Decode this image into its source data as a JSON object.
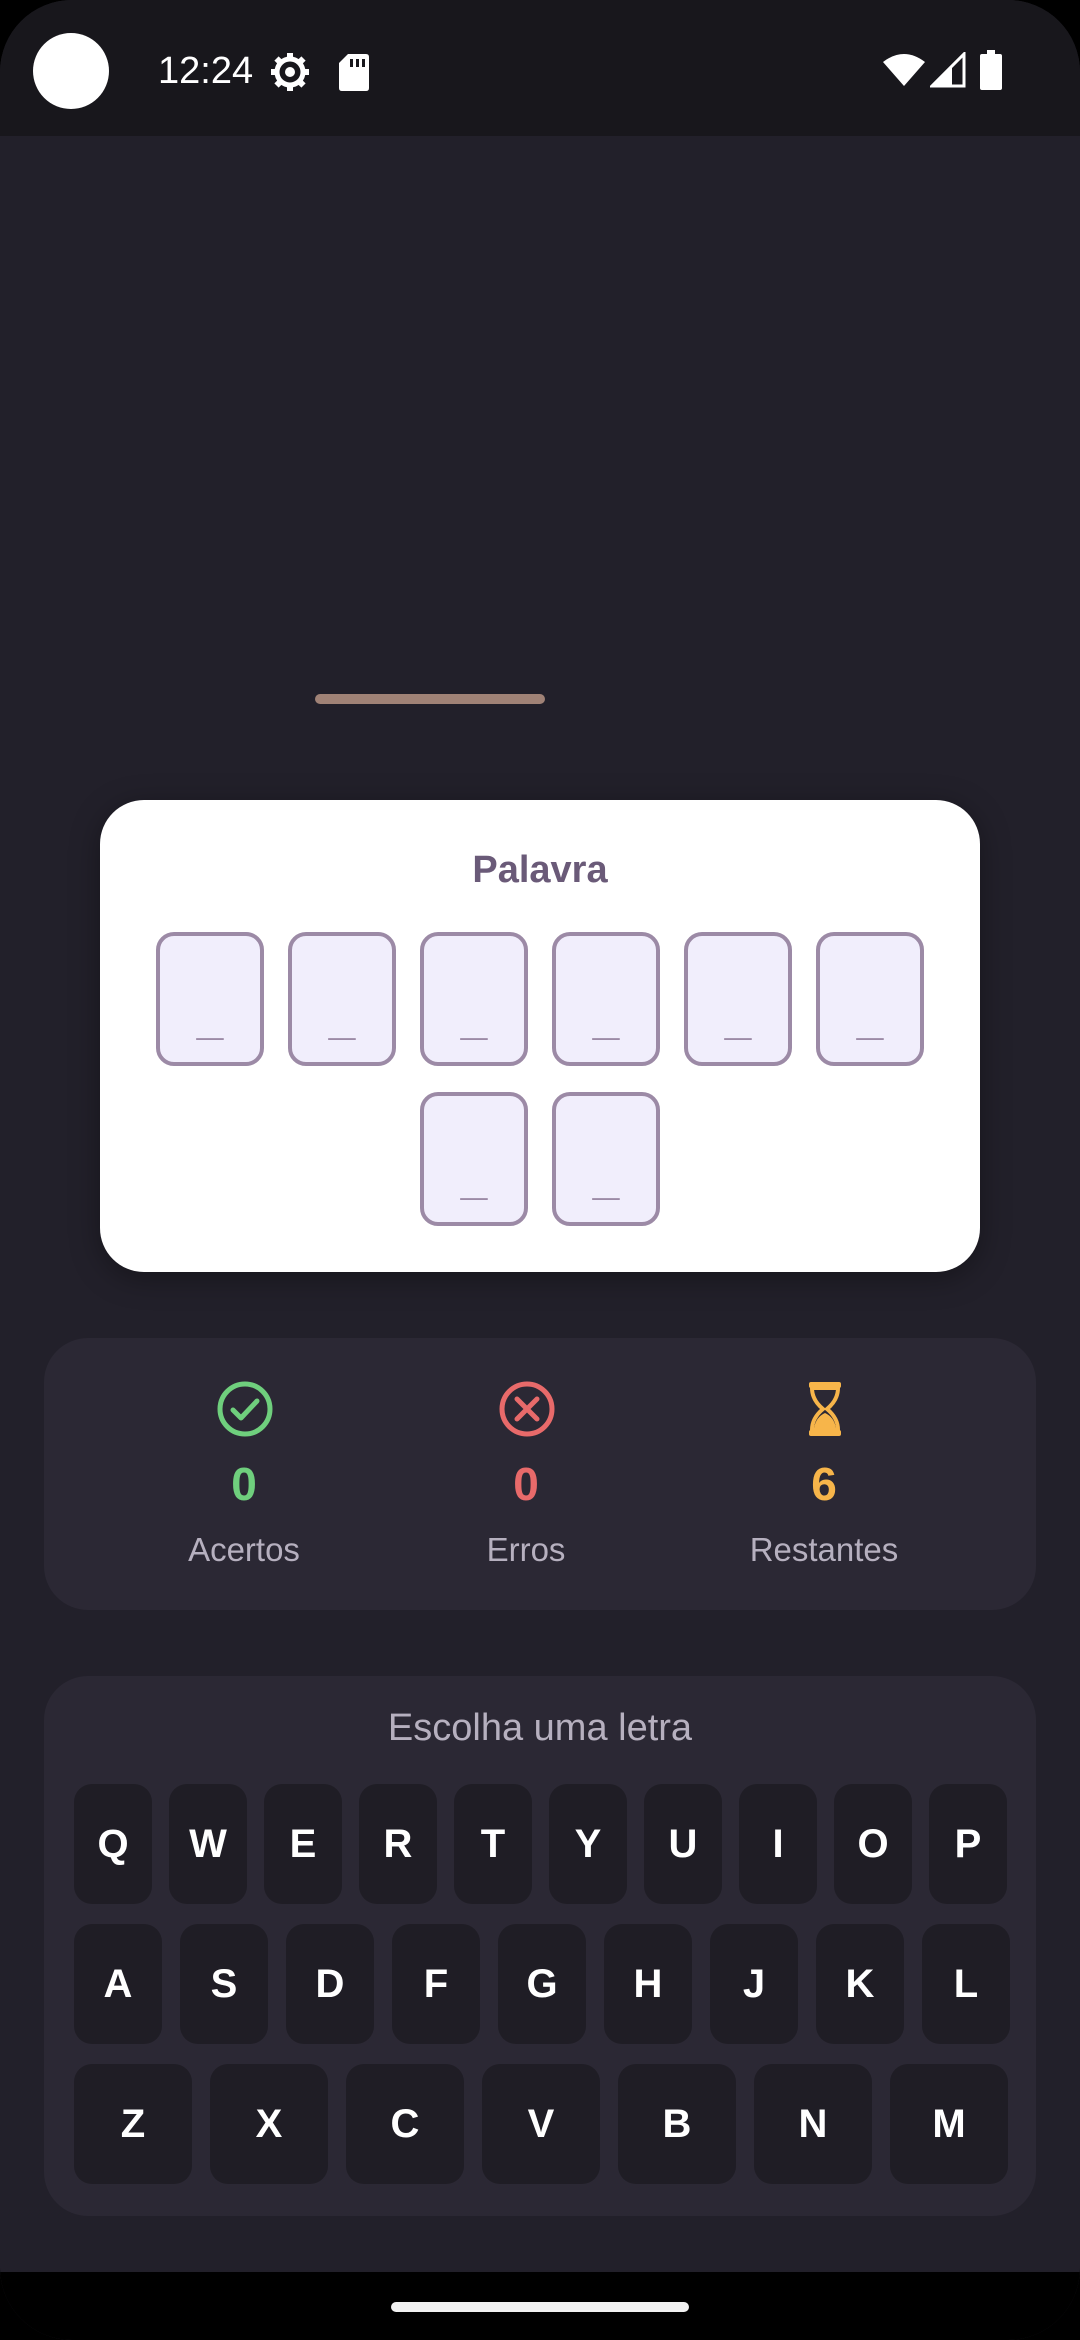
{
  "status_bar": {
    "time": "12:24",
    "icons": [
      "settings-icon",
      "sdcard-icon",
      "wifi-icon",
      "signal-icon",
      "battery-icon"
    ]
  },
  "word_card": {
    "title": "Palavra",
    "slots": [
      "_",
      "_",
      "_",
      "_",
      "_",
      "_",
      "_",
      "_"
    ]
  },
  "stats": {
    "hits": {
      "value": "0",
      "label": "Acertos",
      "icon": "check-circle-icon",
      "color": "#6fcf7d"
    },
    "errors": {
      "value": "0",
      "label": "Erros",
      "icon": "x-circle-icon",
      "color": "#e86a6a"
    },
    "remaining": {
      "value": "6",
      "label": "Restantes",
      "icon": "hourglass-icon",
      "color": "#f7b54a"
    }
  },
  "keyboard": {
    "prompt": "Escolha uma letra",
    "rows": [
      [
        "Q",
        "W",
        "E",
        "R",
        "T",
        "Y",
        "U",
        "I",
        "O",
        "P"
      ],
      [
        "A",
        "S",
        "D",
        "F",
        "G",
        "H",
        "J",
        "K",
        "L"
      ],
      [
        "Z",
        "X",
        "C",
        "V",
        "B",
        "N",
        "M"
      ]
    ]
  },
  "colors": {
    "background": "#22202a",
    "panel": "#2b2834",
    "key": "#1f1d25",
    "slot_fill": "#f1eefc",
    "slot_border": "#9c8aa6"
  }
}
